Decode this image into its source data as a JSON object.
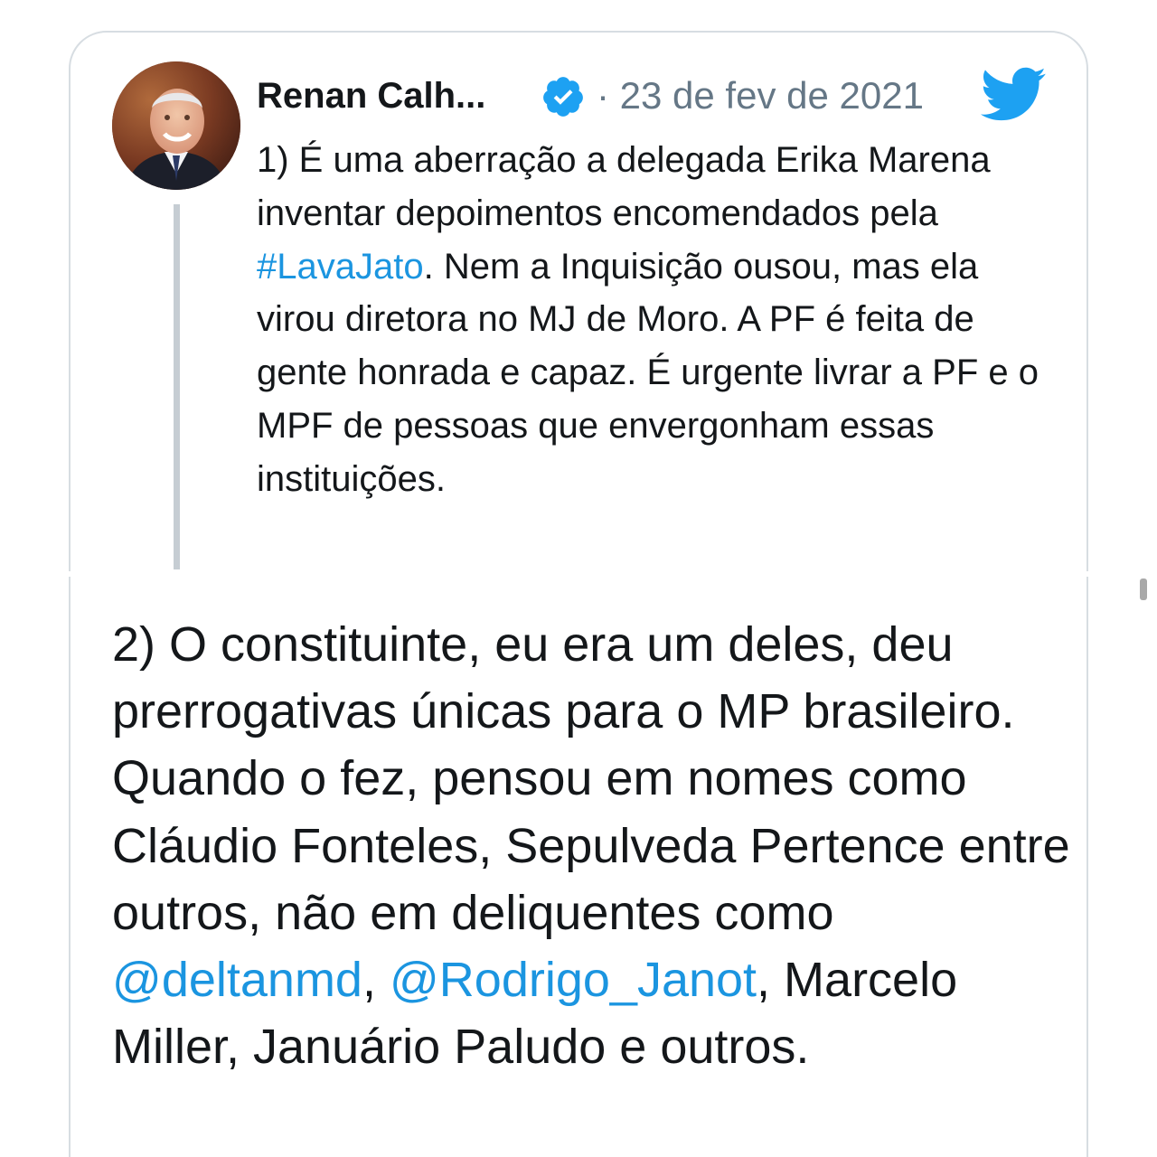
{
  "quoted_tweet": {
    "author_name": "Renan Calh...",
    "date_text": "· 23 de fev de 2021",
    "text_parts": {
      "p1": "1) É uma aberração a delegada Erika Marena inventar depoimentos encomendados pela ",
      "hashtag": "#LavaJato",
      "p2": ". Nem a Inquisição ousou, mas ela virou diretora no MJ de Moro. A PF é feita de gente honrada e capaz. É urgente livrar a PF e o MPF de pessoas que envergonham essas instituições."
    }
  },
  "reply_tweet": {
    "text_parts": {
      "p1": "2) O constituinte, eu era um deles, deu prerrogativas únicas para o MP brasileiro. Quando o fez, pensou em nomes como Cláudio Fonteles, Sepulveda Pertence entre outros, não em deliquentes como ",
      "mention1": "@deltanmd",
      "sep": ", ",
      "mention2": "@Rodrigo_Janot",
      "p2": ", Marcelo Miller, Januário Paludo e outros."
    }
  },
  "icons": {
    "verified": "verified-badge-icon",
    "brand": "twitter-bird-icon"
  },
  "colors": {
    "link": "#1b95e0",
    "verified": "#1da1f2",
    "brand": "#1da1f2",
    "text": "#14171a",
    "muted": "#657786",
    "border": "#d7dde2"
  }
}
